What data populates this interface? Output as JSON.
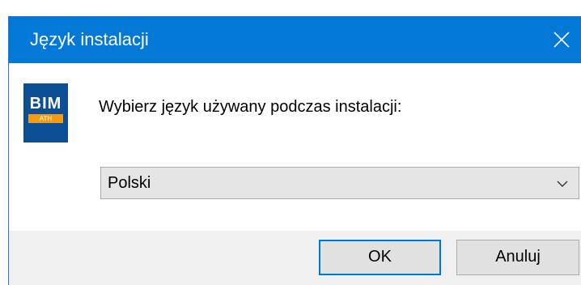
{
  "window": {
    "title": "Język instalacji"
  },
  "logo": {
    "main_text": "BIM",
    "sub_text": "ATH"
  },
  "content": {
    "prompt": "Wybierz język używany podczas instalacji:",
    "language_select": {
      "selected": "Polski"
    }
  },
  "buttons": {
    "ok_label": "OK",
    "cancel_label": "Anuluj"
  },
  "icons": {
    "close": "close-icon",
    "dropdown": "chevron-down-icon"
  },
  "colors": {
    "titlebar": "#0378d7",
    "logo_bg": "#0d4f95",
    "logo_accent": "#f39c12",
    "default_button_border": "#0078d7"
  }
}
